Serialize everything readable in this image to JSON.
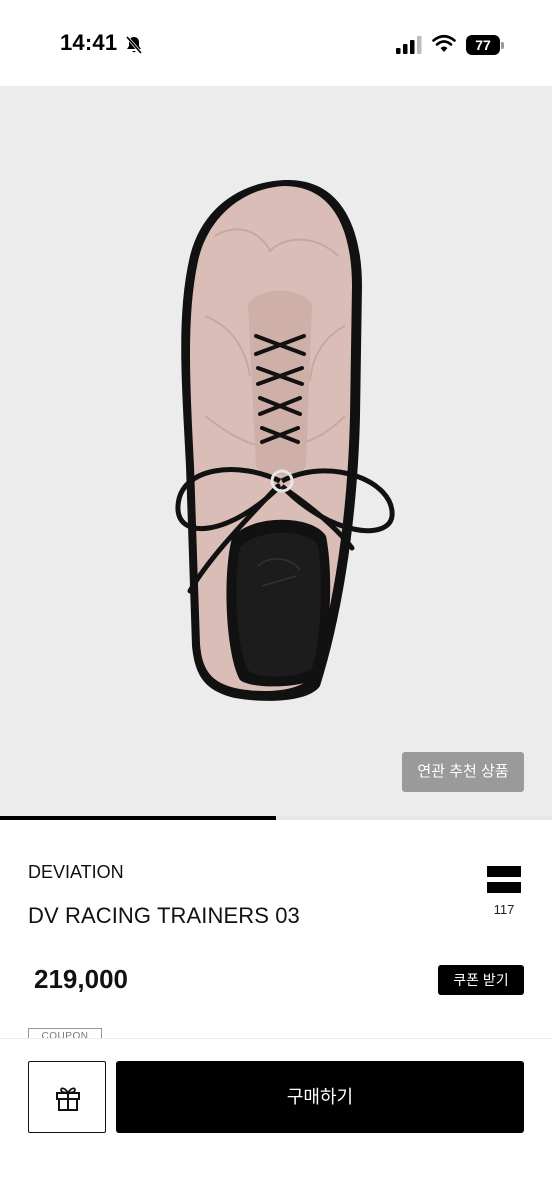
{
  "status_bar": {
    "time": "14:41",
    "battery": "77",
    "icons": [
      "bell-slash-icon",
      "signal-icon",
      "wifi-icon",
      "battery-icon"
    ]
  },
  "product_image": {
    "related_label": "연관 추천 상품",
    "carousel_progress": 0.5,
    "shoe_color": "#d9bdb6",
    "background_color": "#ececec"
  },
  "product": {
    "brand": "DEVIATION",
    "name": "DV RACING TRAINERS 03",
    "like_count": "117",
    "price": "219,000",
    "coupon_label": "쿠폰 받기",
    "coupon_tag": "COUPON"
  },
  "bottom_bar": {
    "gift_icon": "gift-icon",
    "buy_label": "구매하기"
  }
}
